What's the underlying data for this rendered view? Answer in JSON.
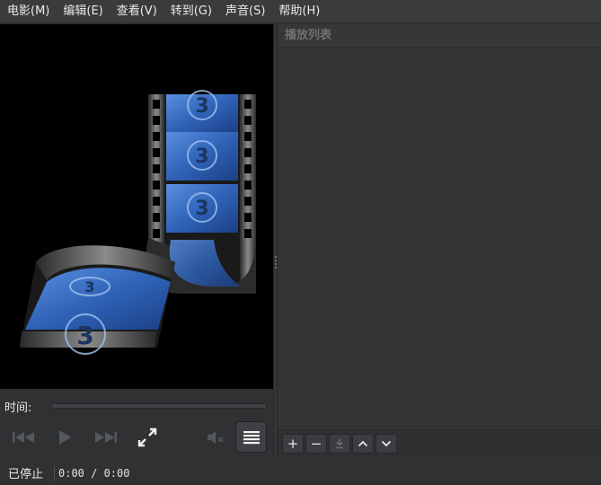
{
  "menubar": {
    "items": [
      {
        "label": "电影(M)"
      },
      {
        "label": "编辑(E)"
      },
      {
        "label": "查看(V)"
      },
      {
        "label": "转到(G)"
      },
      {
        "label": "声音(S)"
      },
      {
        "label": "帮助(H)"
      }
    ]
  },
  "video": {
    "film_frame_number": "3"
  },
  "playlist": {
    "title": "播放列表",
    "toolbar": {
      "add": "+",
      "remove": "−"
    }
  },
  "controls": {
    "time_label": "时间:",
    "seek_position": 0
  },
  "status": {
    "state": "已停止",
    "time": "0:00 / 0:00"
  },
  "icons": {
    "prev": "skip-back-icon",
    "play": "play-icon",
    "next": "skip-forward-icon",
    "fullscreen": "fullscreen-icon",
    "volume": "volume-muted-icon",
    "playlist": "playlist-icon"
  },
  "colors": {
    "film_blue": "#2f63b8",
    "panel": "#333537",
    "video_bg": "#000000"
  }
}
